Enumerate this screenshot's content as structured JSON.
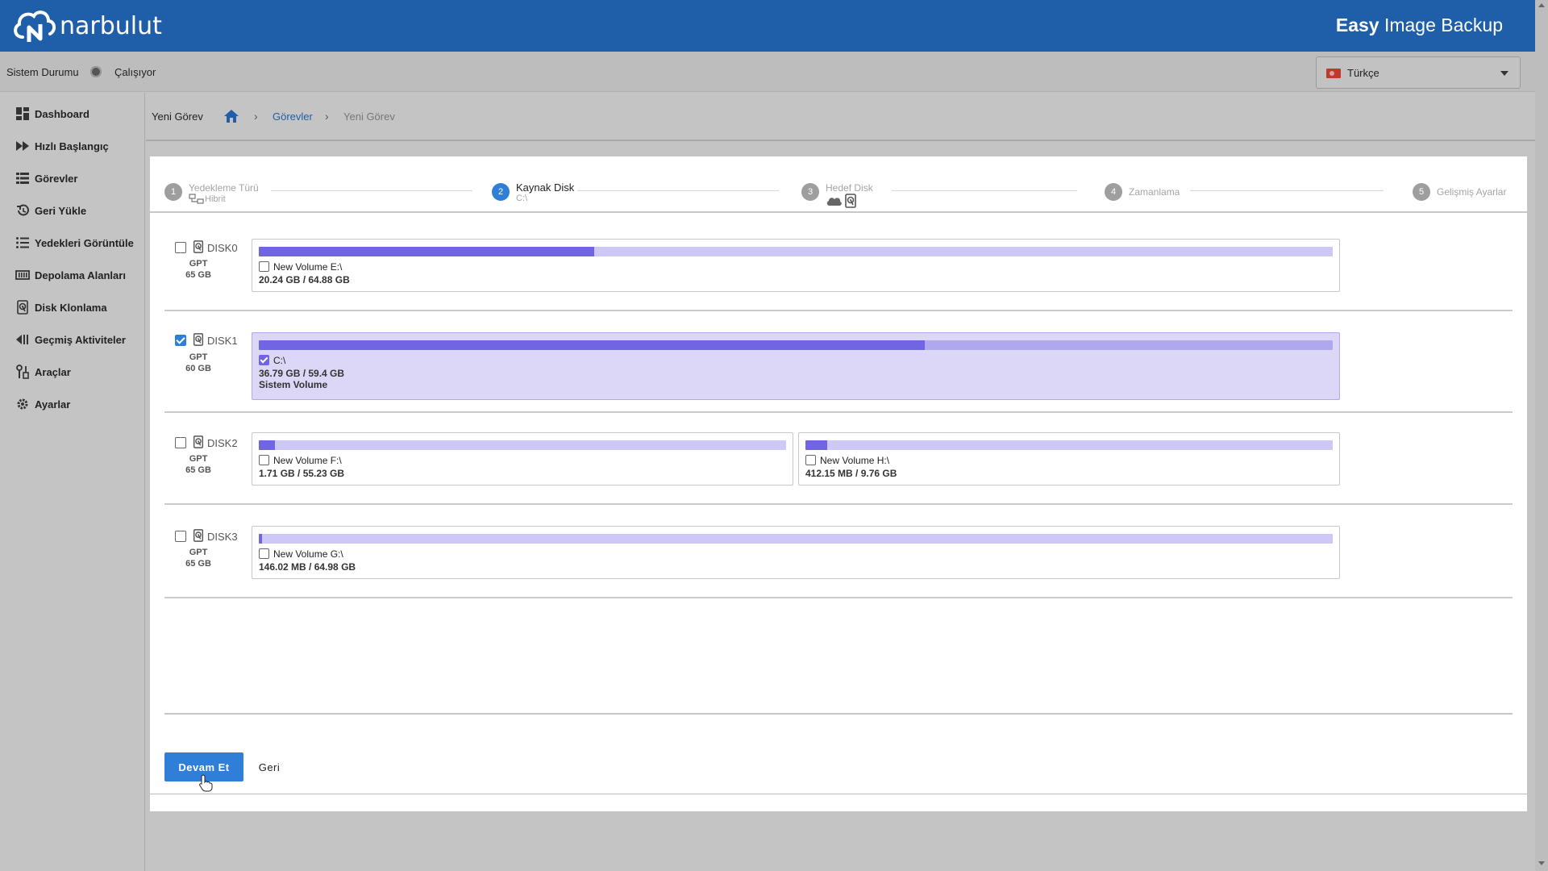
{
  "header": {
    "brand": "narbulut",
    "app_title_bold": "Easy",
    "app_title_rest": " Image Backup"
  },
  "status": {
    "label": "Sistem Durumu",
    "value": "Çalışıyor"
  },
  "language": {
    "selected": "Türkçe"
  },
  "sidebar": {
    "items": [
      {
        "label": "Dashboard",
        "icon": "dashboard-icon"
      },
      {
        "label": "Hızlı Başlangıç",
        "icon": "fast-forward-icon"
      },
      {
        "label": "Görevler",
        "icon": "task-list-icon"
      },
      {
        "label": "Geri Yükle",
        "icon": "restore-icon"
      },
      {
        "label": "Yedekleri Görüntüle",
        "icon": "list-icon"
      },
      {
        "label": "Depolama Alanları",
        "icon": "storage-icon"
      },
      {
        "label": "Disk Klonlama",
        "icon": "disk-icon"
      },
      {
        "label": "Geçmiş Aktiviteler",
        "icon": "history-icon"
      },
      {
        "label": "Araçlar",
        "icon": "tools-icon"
      },
      {
        "label": "Ayarlar",
        "icon": "gear-icon"
      }
    ]
  },
  "breadcrumb": {
    "title": "Yeni Görev",
    "link": "Görevler",
    "current": "Yeni Görev"
  },
  "stepper": {
    "steps": [
      {
        "num": "1",
        "title": "Yedekleme Türü",
        "sub": "Hibrit"
      },
      {
        "num": "2",
        "title": "Kaynak Disk",
        "sub": "C:\\"
      },
      {
        "num": "3",
        "title": "Hedef Disk",
        "sub": ""
      },
      {
        "num": "4",
        "title": "Zamanlama",
        "sub": ""
      },
      {
        "num": "5",
        "title": "Gelişmiş Ayarlar",
        "sub": ""
      }
    ]
  },
  "disks": [
    {
      "name": "DISK0",
      "type": "GPT",
      "size": "65 GB",
      "checked": false,
      "volumes": [
        {
          "label": "New Volume E:\\",
          "size": "20.24 GB / 64.88 GB",
          "used_fraction": 0.312,
          "checked": false,
          "extra": ""
        }
      ]
    },
    {
      "name": "DISK1",
      "type": "GPT",
      "size": "60 GB",
      "checked": true,
      "volumes": [
        {
          "label": "C:\\",
          "size": "36.79 GB / 59.4 GB",
          "used_fraction": 0.62,
          "checked": true,
          "extra": "Sistem Volume"
        }
      ]
    },
    {
      "name": "DISK2",
      "type": "GPT",
      "size": "65 GB",
      "checked": false,
      "volumes": [
        {
          "label": "New Volume F:\\",
          "size": "1.71 GB / 55.23 GB",
          "used_fraction": 0.031,
          "checked": false,
          "extra": ""
        },
        {
          "label": "New Volume H:\\",
          "size": "412.15 MB / 9.76 GB",
          "used_fraction": 0.041,
          "checked": false,
          "extra": ""
        }
      ]
    },
    {
      "name": "DISK3",
      "type": "GPT",
      "size": "65 GB",
      "checked": false,
      "volumes": [
        {
          "label": "New Volume G:\\",
          "size": "146.02 MB / 64.98 GB",
          "used_fraction": 0.002,
          "checked": false,
          "extra": ""
        }
      ]
    }
  ],
  "buttons": {
    "continue": "Devam Et",
    "back": "Geri"
  },
  "colors": {
    "header": "#1f5ea8",
    "accent": "#2f7fd8",
    "volume_fill": "#7265e3",
    "volume_track": "#cdc8f5"
  }
}
